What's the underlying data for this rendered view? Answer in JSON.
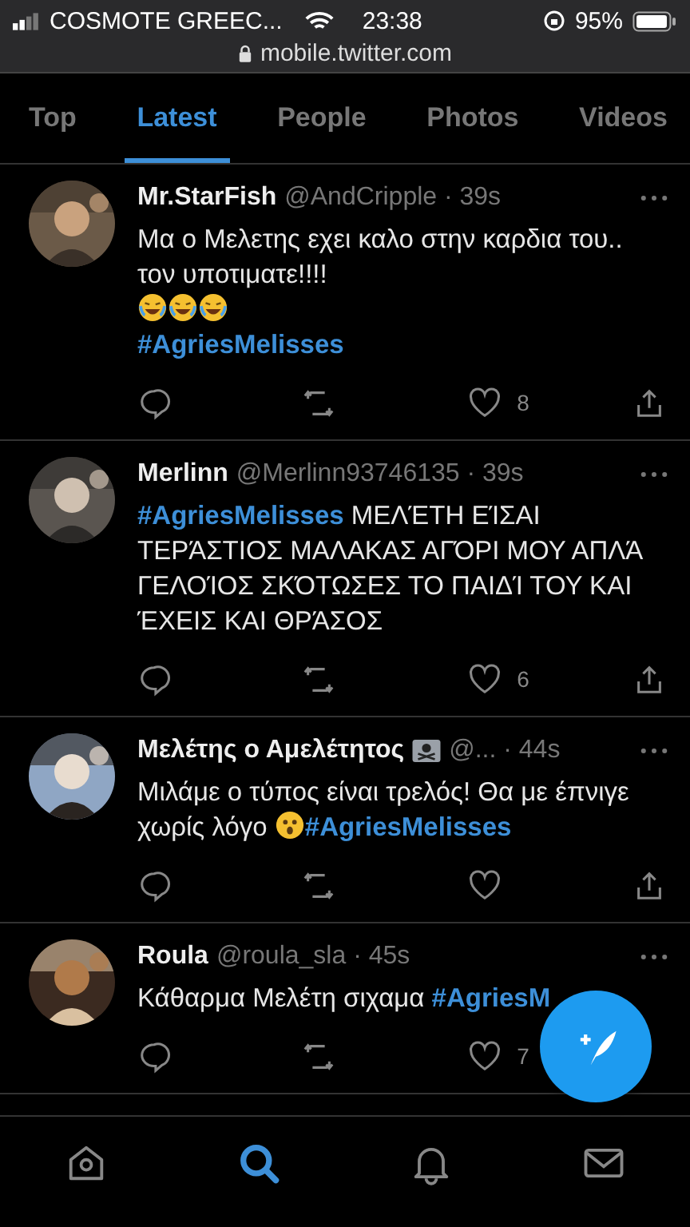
{
  "status_bar": {
    "carrier": "COSMOTE GREEC...",
    "time": "23:38",
    "battery": "95%",
    "url": "mobile.twitter.com"
  },
  "tabs": [
    {
      "label": "Top",
      "selected": false
    },
    {
      "label": "Latest",
      "selected": true
    },
    {
      "label": "People",
      "selected": false
    },
    {
      "label": "Photos",
      "selected": false
    },
    {
      "label": "Videos",
      "selected": false
    }
  ],
  "tweets": [
    {
      "name": "Mr.StarFish",
      "handle": "@AndCripple · 39s",
      "lines": [
        [
          {
            "kind": "text",
            "text": "Μα ο Μελετης εχει καλο στην καρδια του.."
          }
        ],
        [
          {
            "kind": "text",
            "text": "τον υποτιματε!!!!"
          }
        ],
        [
          {
            "kind": "laughing-emoji"
          },
          {
            "kind": "laughing-emoji"
          },
          {
            "kind": "laughing-emoji"
          }
        ],
        [
          {
            "kind": "hashtag",
            "text": "#AgriesMelisses"
          }
        ]
      ],
      "likes": "8"
    },
    {
      "name": "Merlinn",
      "handle": "@Merlinn93746135 · 39s",
      "lines": [
        [
          {
            "kind": "hashtag",
            "text": "#AgriesMelisses"
          },
          {
            "kind": "text",
            "text": " ΜΕΛΈΤΗ ΕΊΣΑΙ ΤΕΡΆΣΤΙΟΣ ΜΑΛΑΚΑΣ ΑΓΌΡΙ ΜΟΥ ΑΠΛΆ ΓΕΛΟΊΟΣ ΣΚΌΤΩΣΕΣ ΤΟ ΠΑΙΔΊ ΤΟΥ ΚΑΙ ΈΧΕΙΣ ΚΑΙ ΘΡΆΣΟΣ"
          }
        ]
      ],
      "likes": "6"
    },
    {
      "name": "Μελέτης ο Αμελέτητος",
      "badge": {
        "kind": "flag"
      },
      "handle": "@... · 44s",
      "lines": [
        [
          {
            "kind": "text",
            "text": "Μιλάμε ο τύπος είναι τρελός! Θα με έπνιγε χωρίς λόγο "
          },
          {
            "kind": "surprised-emoji"
          },
          {
            "kind": "hashtag",
            "text": "#AgriesMelisses"
          }
        ]
      ]
    },
    {
      "name": "Roula",
      "handle": "@roula_sla · 45s",
      "lines": [
        [
          {
            "kind": "text",
            "text": "Κάθαρμα Μελέτη σιχαμα "
          },
          {
            "kind": "hashtag",
            "text": "#AgriesM"
          }
        ]
      ],
      "likes": "7"
    }
  ],
  "nav": [
    {
      "kind": "home",
      "selected": false
    },
    {
      "kind": "search",
      "selected": true
    },
    {
      "kind": "bell",
      "selected": false
    },
    {
      "kind": "mail",
      "selected": false
    }
  ]
}
